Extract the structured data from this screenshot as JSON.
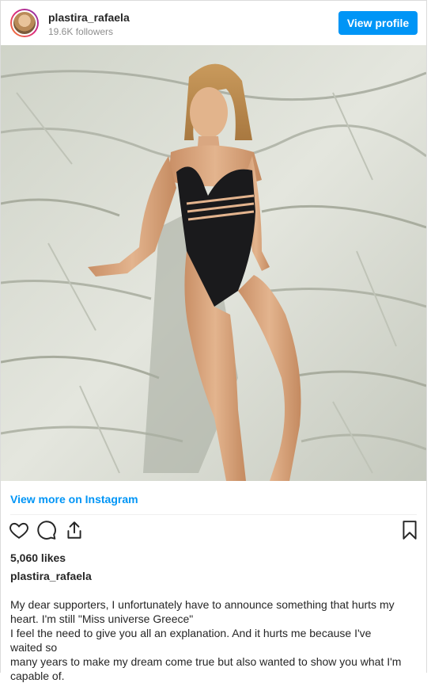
{
  "header": {
    "username": "plastira_rafaela",
    "followers": "19.6K followers",
    "view_profile_label": "View profile"
  },
  "post": {
    "image_alt": "Instagram post photo"
  },
  "view_more_label": "View more on Instagram",
  "actions": {
    "icons": [
      "heart-icon",
      "comment-icon",
      "share-icon",
      "bookmark-icon"
    ]
  },
  "likes": "5,060 likes",
  "caption": {
    "username": "plastira_rafaela",
    "line1": "My dear supporters, I unfortunately have to announce something that hurts my",
    "line2": "heart. I'm still \"Miss universe Greece\"",
    "line3": "I feel the need to give you all an explanation. And it hurts me because I've waited so",
    "line4": "many years to make my dream come true but also wanted to show you what I'm",
    "line5": "capable of."
  },
  "colors": {
    "accent": "#0095f6",
    "text": "#262626",
    "muted": "#8e8e8e",
    "border": "#dbdbdb"
  }
}
